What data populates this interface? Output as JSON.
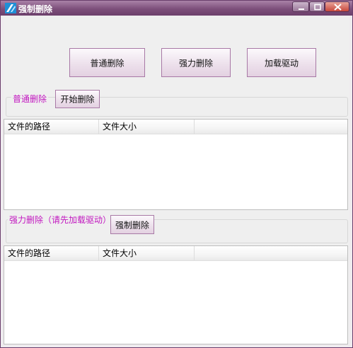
{
  "window": {
    "title": "强制删除",
    "accent_color": "#7d4f7b",
    "controls": {
      "minimize_icon": "minimize-icon",
      "maximize_icon": "maximize-icon",
      "close_icon": "close-icon"
    }
  },
  "toolbar": {
    "normal_delete_label": "普通删除",
    "force_delete_label": "强力删除",
    "load_driver_label": "加载驱动"
  },
  "normal_section": {
    "title": "普通删除",
    "start_button_label": "开始删除",
    "columns": [
      "文件的路径",
      "文件大小"
    ],
    "rows": []
  },
  "force_section": {
    "title": "强力删除（请先加载驱动）",
    "force_button_label": "强制删除",
    "columns": [
      "文件的路径",
      "文件大小"
    ],
    "rows": []
  },
  "colors": {
    "group_label": "#c218c0",
    "button_border": "#a879a6"
  }
}
